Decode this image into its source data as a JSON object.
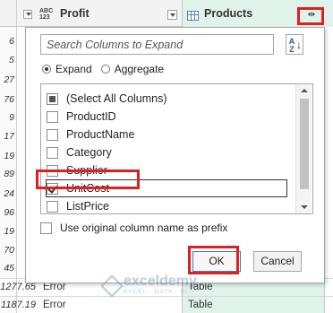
{
  "header": {
    "type_label_top": "ABC",
    "type_label_bottom": "123",
    "profit_column": "Profit",
    "products_column": "Products",
    "expand_glyph": "⇹"
  },
  "row_numbers": [
    "6",
    "5",
    "27",
    "76",
    "9",
    "17",
    "19",
    "89",
    "24",
    "96",
    "19",
    "70",
    "45"
  ],
  "bottom_rows": [
    {
      "profit": "1277.65",
      "value": "Error",
      "products": "Table"
    },
    {
      "profit": "1187.19",
      "value": "Error",
      "products": "Table"
    }
  ],
  "popup": {
    "search_placeholder": "Search Columns to Expand",
    "sort_icon": "sort-az-icon",
    "sort_az": "A Z",
    "mode_options": [
      {
        "label": "Expand",
        "selected": true
      },
      {
        "label": "Aggregate",
        "selected": false
      }
    ],
    "columns": [
      {
        "label": "(Select All Columns)",
        "state": "partial"
      },
      {
        "label": "ProductID",
        "state": "unchecked"
      },
      {
        "label": "ProductName",
        "state": "unchecked"
      },
      {
        "label": "Category",
        "state": "unchecked"
      },
      {
        "label": "Supplier",
        "state": "unchecked"
      },
      {
        "label": "UnitCost",
        "state": "checked"
      },
      {
        "label": "ListPrice",
        "state": "unchecked"
      }
    ],
    "prefix_label": "Use original column name as prefix",
    "prefix_checked": false,
    "ok_label": "OK",
    "cancel_label": "Cancel"
  },
  "watermark": {
    "name": "exceldemy",
    "tagline": "EXCEL · DATA · BI"
  },
  "colors": {
    "highlight": "#e02020",
    "products_fill": "#dff3ea",
    "ok_border": "#3a7cc2"
  }
}
